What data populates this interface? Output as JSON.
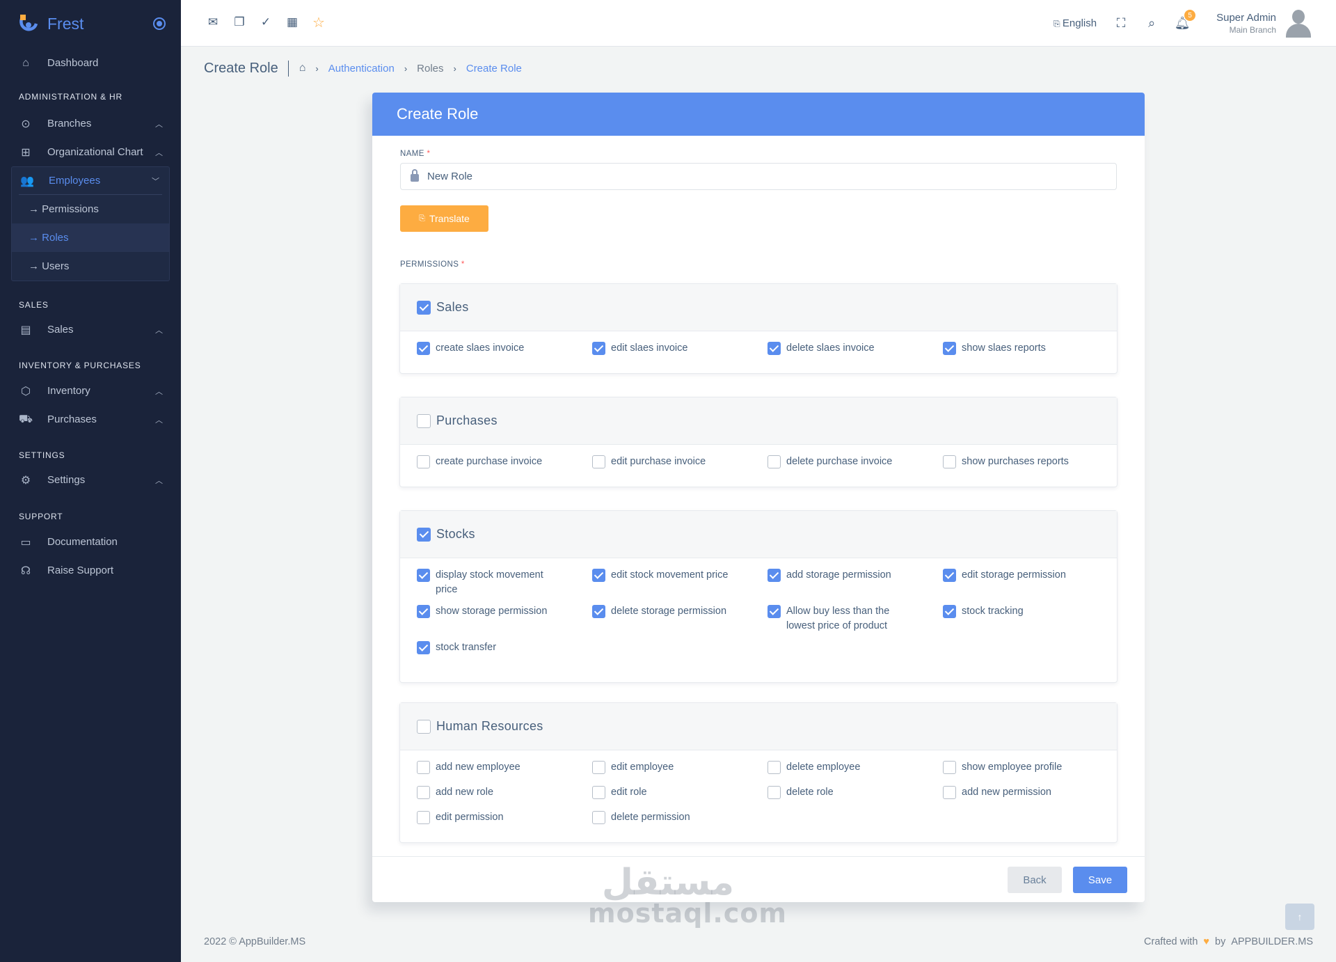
{
  "sidebar": {
    "brand": "Frest",
    "dashboard": "Dashboard",
    "sections": {
      "admin": "Administration & HR",
      "sales": "Sales",
      "inventory": "Inventory & Purchases",
      "settings": "Settings",
      "support": "Support"
    },
    "items": {
      "branches": "Branches",
      "org_chart": "Organizational Chart",
      "employees": "Employees",
      "permissions": "→ Permissions",
      "roles": "→ Roles",
      "users": "→ Users",
      "sales": "Sales",
      "inventory": "Inventory",
      "purchases": "Purchases",
      "settings": "Settings",
      "documentation": "Documentation",
      "raise_support": "Raise Support"
    }
  },
  "topbar": {
    "language": "English",
    "notification_count": "5",
    "user_name": "Super Admin",
    "user_branch": "Main Branch"
  },
  "breadcrumb": {
    "page_title": "Create Role",
    "items": [
      "Authentication",
      "Roles",
      "Create Role"
    ]
  },
  "form": {
    "card_title": "Create Role",
    "name_label": "Name",
    "required_mark": "*",
    "name_value": "New Role",
    "translate_label": "Translate",
    "permissions_label": "Permissions",
    "back_label": "Back",
    "save_label": "Save"
  },
  "permission_groups": [
    {
      "title": "Sales",
      "checked": true,
      "permissions": [
        {
          "label": "create slaes invoice",
          "checked": true
        },
        {
          "label": "edit slaes invoice",
          "checked": true
        },
        {
          "label": "delete slaes invoice",
          "checked": true
        },
        {
          "label": "show slaes reports",
          "checked": true
        }
      ]
    },
    {
      "title": "Purchases",
      "checked": false,
      "permissions": [
        {
          "label": "create purchase invoice",
          "checked": false
        },
        {
          "label": "edit purchase invoice",
          "checked": false
        },
        {
          "label": "delete purchase invoice",
          "checked": false
        },
        {
          "label": "show purchases reports",
          "checked": false
        }
      ]
    },
    {
      "title": "Stocks",
      "checked": true,
      "permissions": [
        {
          "label": "display stock movement price",
          "checked": true
        },
        {
          "label": "edit stock movement price",
          "checked": true
        },
        {
          "label": "add storage permission",
          "checked": true
        },
        {
          "label": "edit storage permission",
          "checked": true
        },
        {
          "label": "show storage permission",
          "checked": true
        },
        {
          "label": "delete storage permission",
          "checked": true
        },
        {
          "label": "Allow buy less than the lowest price of product",
          "checked": true
        },
        {
          "label": "stock tracking",
          "checked": true
        },
        {
          "label": "stock transfer",
          "checked": true
        }
      ]
    },
    {
      "title": "Human Resources",
      "checked": false,
      "permissions": [
        {
          "label": "add new employee",
          "checked": false
        },
        {
          "label": "edit employee",
          "checked": false
        },
        {
          "label": "delete employee",
          "checked": false
        },
        {
          "label": "show employee profile",
          "checked": false
        },
        {
          "label": "add new role",
          "checked": false
        },
        {
          "label": "edit role",
          "checked": false
        },
        {
          "label": "delete role",
          "checked": false
        },
        {
          "label": "add new permission",
          "checked": false
        },
        {
          "label": "edit permission",
          "checked": false
        },
        {
          "label": "delete permission",
          "checked": false
        }
      ]
    }
  ],
  "watermark": {
    "arabic": "مستقل",
    "latin": "mostaql.com"
  },
  "footer": {
    "copyright": "2022 © AppBuilder.MS",
    "crafted_with": "Crafted with",
    "by": "by",
    "company": "APPBUILDER.MS"
  },
  "colors": {
    "primary": "#5a8dee",
    "warning": "#fdac41",
    "sidebar_bg": "#1a233a",
    "page_bg": "#f2f4f4"
  }
}
